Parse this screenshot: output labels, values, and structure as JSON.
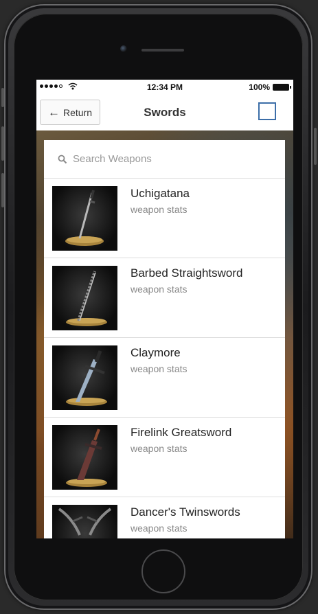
{
  "status_bar": {
    "time": "12:34 PM",
    "battery": "100%"
  },
  "nav": {
    "return_label": "Return",
    "title": "Swords"
  },
  "search": {
    "placeholder": "Search Weapons"
  },
  "weapons": [
    {
      "name": "Uchigatana",
      "subtitle": "weapon stats"
    },
    {
      "name": "Barbed Straightsword",
      "subtitle": "weapon stats"
    },
    {
      "name": "Claymore",
      "subtitle": "weapon stats"
    },
    {
      "name": "Firelink Greatsword",
      "subtitle": "weapon stats"
    },
    {
      "name": "Dancer's Twinswords",
      "subtitle": "weapon stats"
    }
  ],
  "colors": {
    "accent": "#3c6ea8"
  }
}
